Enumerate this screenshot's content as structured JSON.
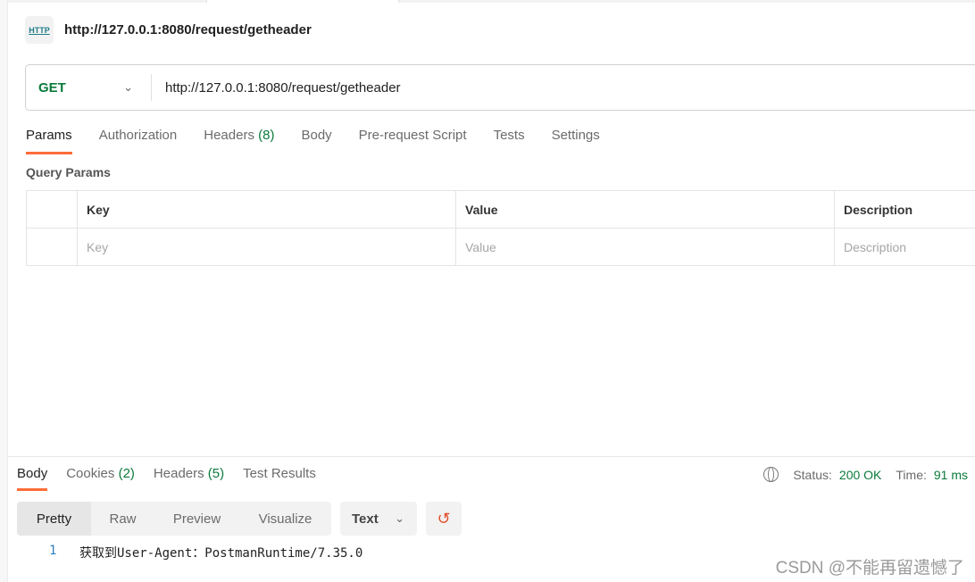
{
  "title": "http://127.0.0.1:8080/request/getheader",
  "http_icon": "HTTP",
  "request": {
    "method": "GET",
    "url": "http://127.0.0.1:8080/request/getheader"
  },
  "req_tabs": [
    {
      "label": "Params"
    },
    {
      "label": "Authorization"
    },
    {
      "label": "Headers",
      "count": "(8)"
    },
    {
      "label": "Body"
    },
    {
      "label": "Pre-request Script"
    },
    {
      "label": "Tests"
    },
    {
      "label": "Settings"
    }
  ],
  "query_params": {
    "heading": "Query Params",
    "columns": [
      "Key",
      "Value",
      "Description"
    ],
    "placeholders": [
      "Key",
      "Value",
      "Description"
    ]
  },
  "res_tabs": [
    {
      "label": "Body"
    },
    {
      "label": "Cookies",
      "count": "(2)"
    },
    {
      "label": "Headers",
      "count": "(5)"
    },
    {
      "label": "Test Results"
    }
  ],
  "status": {
    "status_label": "Status:",
    "status_value": "200 OK",
    "time_label": "Time:",
    "time_value": "91 ms"
  },
  "view_modes": [
    "Pretty",
    "Raw",
    "Preview",
    "Visualize"
  ],
  "format": "Text",
  "body_lines": [
    {
      "n": "1",
      "text": "获取到User-Agent：PostmanRuntime/7.35.0"
    }
  ],
  "watermark": "CSDN @不能再留遗憾了",
  "colors": {
    "accent": "#ff6c37",
    "success": "#0b7a3b"
  }
}
